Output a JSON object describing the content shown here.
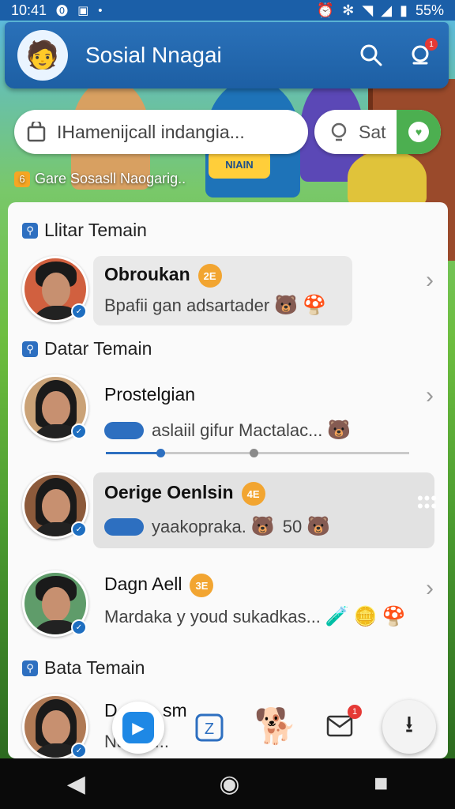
{
  "status_bar": {
    "time": "10:41",
    "battery": "55%"
  },
  "header": {
    "title": "Sosial Nnagai",
    "notification_count": "1"
  },
  "search": {
    "placeholder": "IHamenijcall indangia..."
  },
  "sat_pill": {
    "label": "Sat"
  },
  "game_label": "Gare Sosasll Naogarig..",
  "sections": {
    "s1": "Llitar Temain",
    "s2": "Datar Temain",
    "s3": "Bata Temain"
  },
  "rows": {
    "r1": {
      "name": "Obroukan",
      "level": "2E",
      "message": "Bpafii gan adsartader"
    },
    "r2": {
      "name": "Prostelgian",
      "message": "aslaiil gifur Mactalac..."
    },
    "r3": {
      "name": "Oerige Oenlsin",
      "level": "4E",
      "message": "yaakopraka.",
      "score": "50"
    },
    "r4": {
      "name": "Dagn Aell",
      "level": "3E",
      "message": "Mardaka y youd sukadkas..."
    },
    "r5": {
      "name": "D",
      "name_tail": "sm",
      "message": "Naadk..."
    }
  },
  "bottom_nav": {
    "mail_badge": "1"
  },
  "colors": {
    "primary": "#1d5fa4",
    "accent": "#2d6fc0",
    "level": "#f2a531",
    "green": "#4caf50"
  }
}
